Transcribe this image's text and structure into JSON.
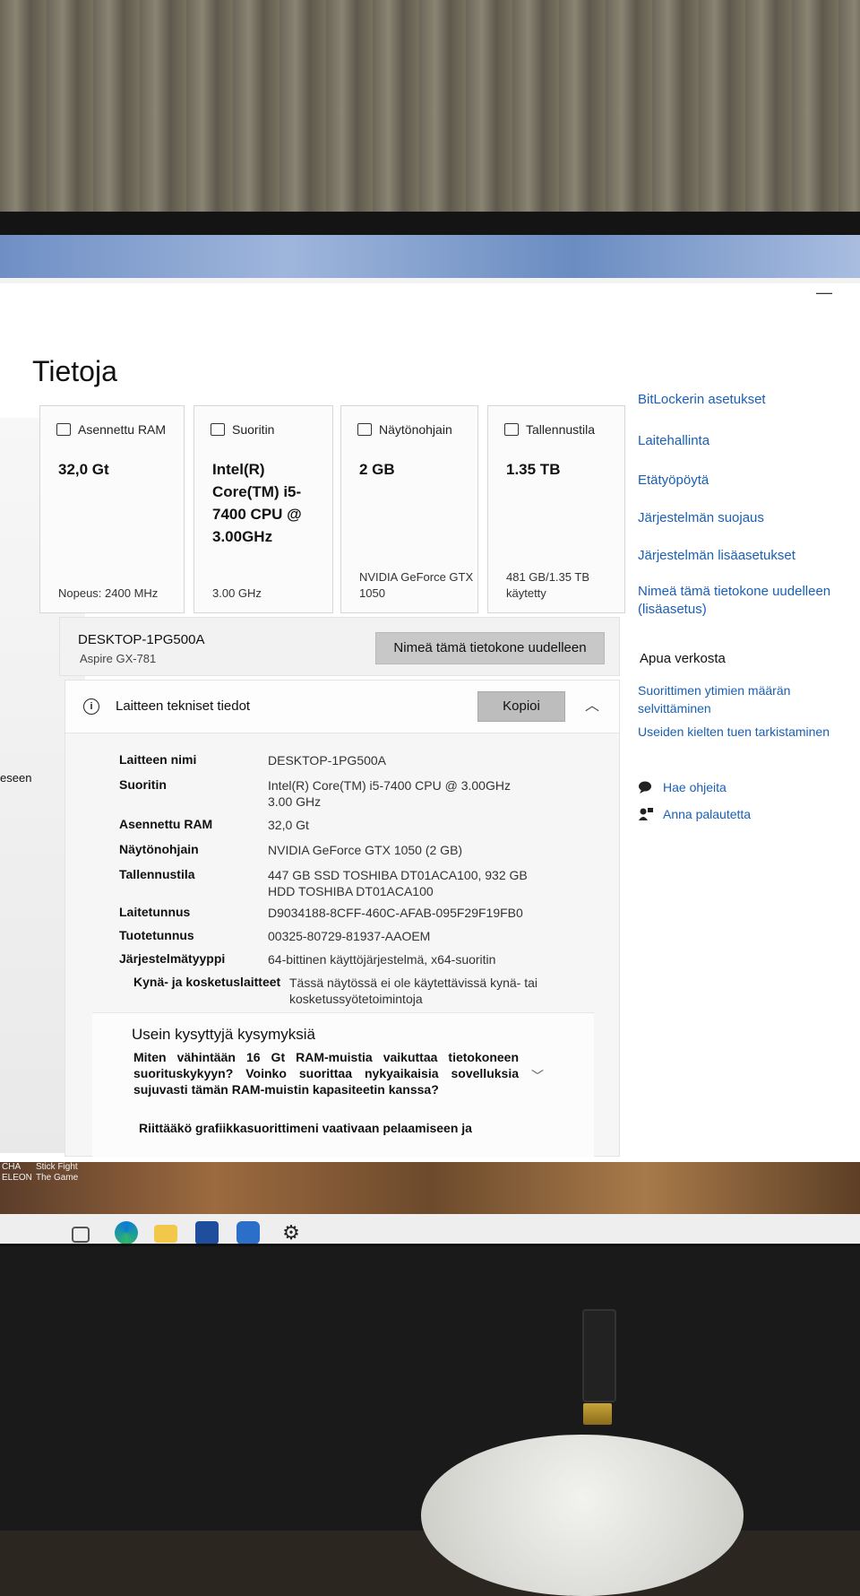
{
  "window": {
    "title": "Tietoja",
    "minimize_glyph": "—"
  },
  "left_fragments": [
    "eseen",
    "CHA",
    "ELEON"
  ],
  "cards": [
    {
      "label": "Asennettu RAM",
      "value": "32,0 Gt",
      "sub": "Nopeus: 2400 MHz",
      "icon": "ram-icon"
    },
    {
      "label": "Suoritin",
      "value": "Intel(R) Core(TM) i5-7400 CPU @ 3.00GHz",
      "sub": "3.00 GHz",
      "icon": "cpu-icon"
    },
    {
      "label": "Näytönohjain",
      "value": "2 GB",
      "sub": "NVIDIA GeForce GTX 1050",
      "icon": "gpu-icon"
    },
    {
      "label": "Tallennustila",
      "value": "1.35 TB",
      "sub": "481 GB/1.35 TB käytetty",
      "icon": "storage-icon"
    }
  ],
  "pc": {
    "name": "DESKTOP-1PG500A",
    "model": "Aspire GX-781",
    "rename_button": "Nimeä tämä tietokone uudelleen"
  },
  "specs": {
    "title": "Laitteen tekniset tiedot",
    "copy_button": "Kopioi",
    "rows": [
      {
        "key": "Laitteen nimi",
        "value": "DESKTOP-1PG500A"
      },
      {
        "key": "Suoritin",
        "value": "Intel(R) Core(TM) i5-7400 CPU @ 3.00GHz   3.00 GHz"
      },
      {
        "key": "Asennettu RAM",
        "value": "32,0 Gt"
      },
      {
        "key": "Näytönohjain",
        "value": "NVIDIA GeForce GTX 1050 (2 GB)"
      },
      {
        "key": "Tallennustila",
        "value": "447 GB SSD TOSHIBA DT01ACA100, 932 GB HDD TOSHIBA DT01ACA100"
      },
      {
        "key": "Laitetunnus",
        "value": "D9034188-8CFF-460C-AFAB-095F29F19FB0"
      },
      {
        "key": "Tuotetunnus",
        "value": "00325-80729-81937-AAOEM"
      },
      {
        "key": "Järjestelmätyyppi",
        "value": "64-bittinen käyttöjärjestelmä, x64-suoritin"
      },
      {
        "key": "Kynä- ja kosketuslaitteet",
        "value": "Tässä näytössä ei ole käytettävissä kynä- tai kosketussyötetoimintoja"
      }
    ]
  },
  "faq": {
    "title": "Usein kysyttyjä kysymyksiä",
    "q1": "Miten vähintään 16 Gt RAM-muistia vaikuttaa tietokoneen suorituskykyyn? Voinko suorittaa nykyaikaisia sovelluksia sujuvasti tämän RAM-muistin kapasiteetin kanssa?",
    "q2": "Riittääkö grafiikkasuorittimeni vaativaan pelaamiseen ja"
  },
  "related_links": [
    "BitLockerin asetukset",
    "Laitehallinta",
    "Etätyöpöytä",
    "Järjestelmän suojaus",
    "Järjestelmän lisäasetukset",
    "Nimeä tämä tietokone uudelleen (lisäasetus)"
  ],
  "help": {
    "title": "Apua verkosta",
    "links": [
      "Suorittimen ytimien määrän selvittäminen",
      "Useiden kielten tuen tarkistaminen"
    ],
    "get_help": "Hae ohjeita",
    "feedback": "Anna palautetta"
  },
  "desktop": {
    "icon_label": "Stick Fight The Game"
  },
  "taskbar": {
    "icons": [
      "task-view-icon",
      "edge-icon",
      "file-explorer-icon",
      "store-icon",
      "mail-icon",
      "settings-icon"
    ]
  },
  "colors": {
    "link": "#1a5fb4",
    "button": "#c8c8c8"
  }
}
